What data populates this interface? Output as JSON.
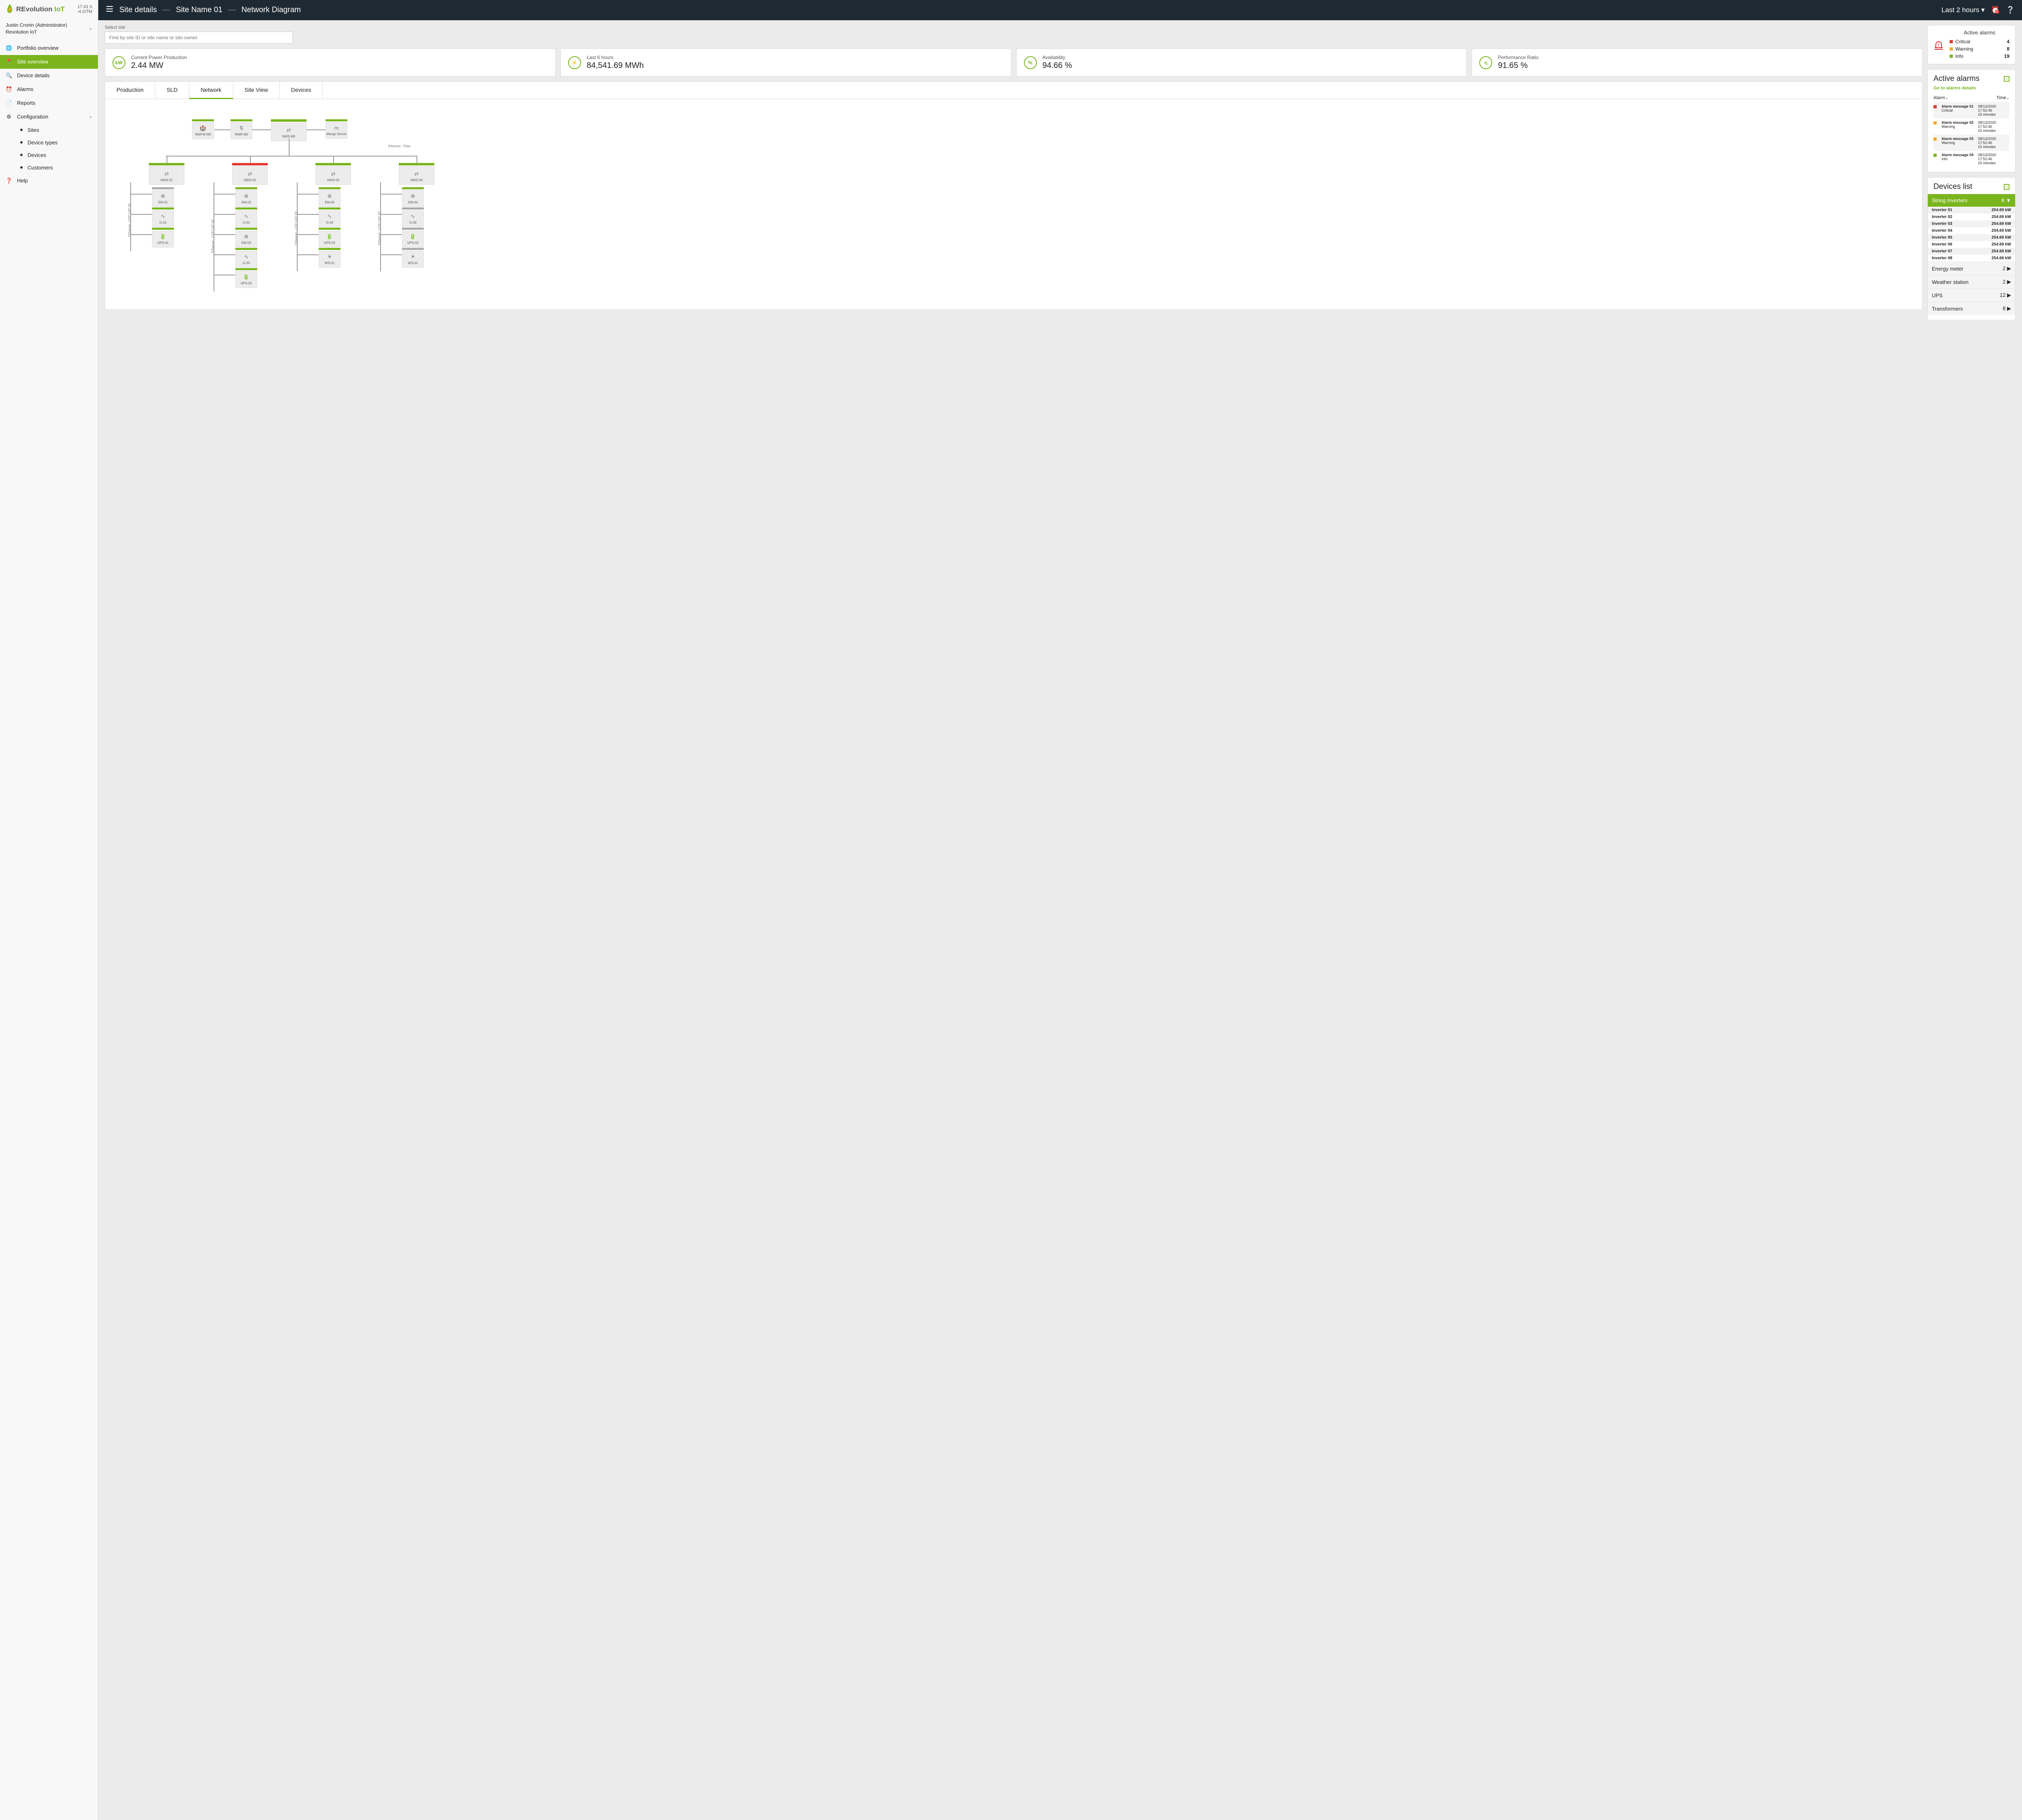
{
  "header": {
    "clock_time": "17:41 h",
    "clock_tz": "-4 GTM",
    "logo_main": "REvolution",
    "logo_sub": "IoT",
    "user_name": "Justin Cronin (Administrator)",
    "user_org": "Revolution IoT"
  },
  "nav": {
    "items": [
      {
        "icon": "🌐",
        "label": "Portfolio overview"
      },
      {
        "icon": "📍",
        "label": "Site overview"
      },
      {
        "icon": "🔍",
        "label": "Device details"
      },
      {
        "icon": "⏰",
        "label": "Alarms"
      },
      {
        "icon": "📄",
        "label": "Reports"
      },
      {
        "icon": "⚙",
        "label": "Configuration"
      }
    ],
    "sub": [
      "Sites",
      "Device types",
      "Devices",
      "Customers"
    ],
    "help": "Help"
  },
  "topbar": {
    "crumb1": "Site details",
    "crumb2": "Site Name 01",
    "crumb3": "Network Diagram",
    "range": "Last 2 hours"
  },
  "search": {
    "label": "Select site",
    "placeholder": "Find by site ID or site name or site owner"
  },
  "kpis": [
    {
      "icon": "kW",
      "label": "Current Power Production",
      "value": "2.44 MW"
    },
    {
      "icon": "⚡",
      "label": "Last 6 hours",
      "value": "84,541.69 MWh"
    },
    {
      "icon": "%",
      "label": "Availability",
      "value": "94.66 %"
    },
    {
      "icon": "η",
      "label": "Performance Ratio",
      "value": "91.65 %"
    }
  ],
  "alarm_summary": {
    "title": "Active alarms",
    "rows": [
      {
        "label": "Critical",
        "count": "4"
      },
      {
        "label": "Warning",
        "count": "8"
      },
      {
        "label": "Info",
        "count": "19"
      }
    ]
  },
  "tabs": [
    "Production",
    "SLD",
    "Network",
    "Site View",
    "Devices"
  ],
  "diagram": {
    "edge_main": "Ethernet - Fiber",
    "edge_branch": "Ethernet - UTP CAT 5E",
    "top": [
      {
        "label": "NWFW-M0",
        "icon": "🏰"
      },
      {
        "label": "NWR-M0",
        "icon": "⇅"
      },
      {
        "label": "NWS-M0",
        "icon": "⇄"
      },
      {
        "label": "Mango Server",
        "icon": "m"
      }
    ],
    "branches": [
      {
        "label": "NWS-01",
        "bar": "grn",
        "children": [
          {
            "label": "EM-01",
            "bar": "gray"
          },
          {
            "label": "G-01",
            "bar": "grn"
          },
          {
            "label": "UPS-01",
            "bar": "grn"
          }
        ]
      },
      {
        "label": "NWS-02",
        "bar": "red",
        "children": [
          {
            "label": "EM-02",
            "bar": "grn"
          },
          {
            "label": "G-02",
            "bar": "grn"
          },
          {
            "label": "EM-03",
            "bar": "grn"
          },
          {
            "label": "G-03",
            "bar": "grn"
          },
          {
            "label": "UPS-02",
            "bar": "grn"
          }
        ]
      },
      {
        "label": "NWS-03",
        "bar": "grn",
        "children": [
          {
            "label": "EM-04",
            "bar": "grn"
          },
          {
            "label": "G-04",
            "bar": "grn"
          },
          {
            "label": "UPS-02",
            "bar": "grn"
          },
          {
            "label": "WS-01",
            "bar": "grn"
          }
        ]
      },
      {
        "label": "NWS-04",
        "bar": "grn",
        "children": [
          {
            "label": "EM-04",
            "bar": "grn"
          },
          {
            "label": "G-04",
            "bar": "gray"
          },
          {
            "label": "UPS-02",
            "bar": "gray"
          },
          {
            "label": "WS-01",
            "bar": "gray"
          }
        ]
      }
    ]
  },
  "alarms_panel": {
    "title": "Active alarms",
    "link": "Go to alarms details",
    "col1": "Alarm",
    "col2": "Time",
    "rows": [
      {
        "c": "red",
        "msg": "Alarm message 01",
        "sev": "Critical",
        "ts": "08/13/2020 17:52:46",
        "ago": "15 minutes"
      },
      {
        "c": "org",
        "msg": "Alarm message 02",
        "sev": "Warning",
        "ts": "08/13/2020 17:52:46",
        "ago": "15 minutes"
      },
      {
        "c": "org",
        "msg": "Alarm message 03",
        "sev": "Warning",
        "ts": "08/13/2020 17:52:46",
        "ago": "15 minutes"
      },
      {
        "c": "grn",
        "msg": "Alarm message 04",
        "sev": "Info",
        "ts": "08/13/2020 17:52:46",
        "ago": "15 minutes"
      }
    ]
  },
  "devices_panel": {
    "title": "Devices list",
    "cats": [
      {
        "label": "String Inverters",
        "count": "8",
        "open": true
      },
      {
        "label": "Energy meter",
        "count": "2"
      },
      {
        "label": "Weather station",
        "count": "2"
      },
      {
        "label": "UPS",
        "count": "12"
      },
      {
        "label": "Transformers",
        "count": "8"
      }
    ],
    "inverters": [
      {
        "name": "Inverter 01",
        "val": "254.69 kW"
      },
      {
        "name": "Inverter 02",
        "val": "254.69 kW"
      },
      {
        "name": "Inverter 03",
        "val": "254.69 kW"
      },
      {
        "name": "Inverter 04",
        "val": "254.69 kW"
      },
      {
        "name": "Inverter 05",
        "val": "254.69 kW"
      },
      {
        "name": "Inverter 06",
        "val": "254.69 kW"
      },
      {
        "name": "Inverter 07",
        "val": "254.69 kW"
      },
      {
        "name": "Inverter 08",
        "val": "254.69 kW"
      }
    ]
  }
}
